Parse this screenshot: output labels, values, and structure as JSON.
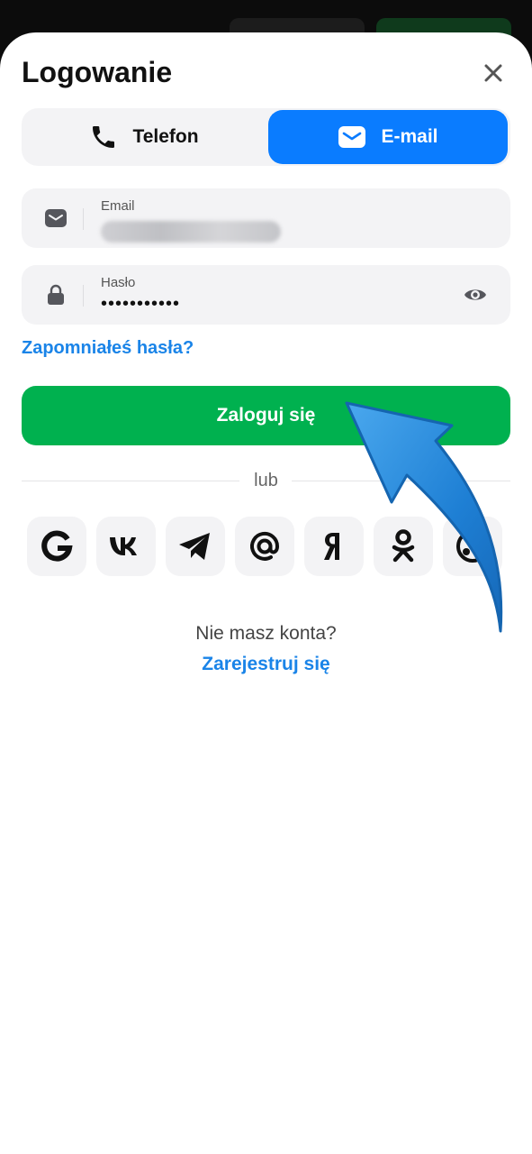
{
  "header": {
    "title": "Logowanie",
    "close_icon": "close-icon"
  },
  "tabs": [
    {
      "label": "Telefon",
      "icon": "phone-icon",
      "active": false
    },
    {
      "label": "E-mail",
      "icon": "envelope-icon",
      "active": true
    }
  ],
  "email_field": {
    "label": "Email",
    "value_obscured": true,
    "icon": "envelope-icon"
  },
  "password_field": {
    "label": "Hasło",
    "value": "•••••••••••",
    "icon": "lock-icon",
    "toggle_icon": "eye-icon"
  },
  "forgot_link": "Zapomniałeś hasła?",
  "login_button": "Zaloguj się",
  "separator": "lub",
  "socials": [
    {
      "name": "google",
      "icon": "google-icon"
    },
    {
      "name": "vk",
      "icon": "vk-icon"
    },
    {
      "name": "telegram",
      "icon": "telegram-icon"
    },
    {
      "name": "mail",
      "icon": "at-icon"
    },
    {
      "name": "yandex",
      "icon": "yandex-icon"
    },
    {
      "name": "odnoklassniki",
      "icon": "ok-icon"
    },
    {
      "name": "steam",
      "icon": "steam-icon"
    }
  ],
  "signup": {
    "prompt": "Nie masz konta?",
    "link": "Zarejestruj się"
  },
  "colors": {
    "accent_blue": "#0a7cff",
    "link_blue": "#1a84e8",
    "primary_green": "#00b14f",
    "field_bg": "#f3f3f5"
  },
  "annotation": {
    "icon": "curved-arrow-icon",
    "color": "#1e88e5"
  }
}
